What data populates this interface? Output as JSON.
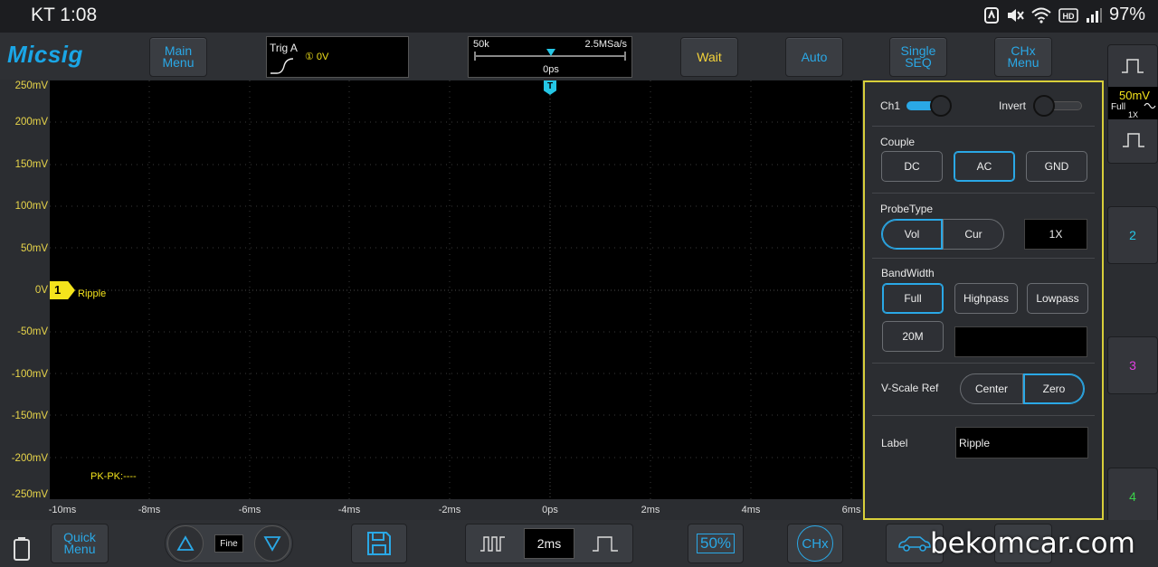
{
  "status_bar": {
    "time_text": "KT 1:08",
    "battery": "97%",
    "icons": [
      "nfc-icon",
      "mute-icon",
      "wifi-icon",
      "hd-icon",
      "signal-icon",
      "battery-icon"
    ]
  },
  "toolbar": {
    "logo": "Micsig",
    "main_menu": [
      "Main",
      "Menu"
    ],
    "trigger": {
      "title": "Trig A",
      "source": "① 0V"
    },
    "timebase": {
      "memory": "50k",
      "sample_rate": "2.5MSa/s",
      "position": "0ps"
    },
    "wait": "Wait",
    "auto": "Auto",
    "single_seq": [
      "Single",
      "SEQ"
    ],
    "chx_menu": [
      "CHx",
      "Menu"
    ]
  },
  "screen": {
    "y_ticks": [
      "250mV",
      "200mV",
      "150mV",
      "100mV",
      "50mV",
      "0V",
      "-50mV",
      "-100mV",
      "-150mV",
      "-200mV",
      "-250mV"
    ],
    "x_ticks": [
      "-10ms",
      "-8ms",
      "-6ms",
      "-4ms",
      "-2ms",
      "0ps",
      "2ms",
      "4ms",
      "6ms"
    ],
    "ch1_marker": "1",
    "ch1_label": "Ripple",
    "trigger_marker": "T",
    "measurement": "PK-PK:----"
  },
  "side_panel": {
    "ch1_label": "Ch1",
    "ch1_on": true,
    "invert_label": "Invert",
    "invert_on": false,
    "couple_label": "Couple",
    "couple_options": [
      "DC",
      "AC",
      "GND"
    ],
    "couple_selected": "AC",
    "probe_label": "ProbeType",
    "probe_options": [
      "Vol",
      "Cur"
    ],
    "probe_selected": "Vol",
    "probe_ratio": "1X",
    "bandwidth_label": "BandWidth",
    "bandwidth_options": [
      "Full",
      "Highpass",
      "Lowpass",
      "20M"
    ],
    "bandwidth_selected": "Full",
    "vscale_label": "V-Scale Ref",
    "vscale_options": [
      "Center",
      "Zero"
    ],
    "vscale_selected": "Zero",
    "label_label": "Label",
    "label_value": "Ripple"
  },
  "channels": {
    "ch1_scale": "50mV",
    "ch1_bw": "Full",
    "ch1_probe": "1X",
    "ch2": "2",
    "ch3": "3",
    "ch4": "4",
    "colors": {
      "ch1": "#f4e41c",
      "ch2": "#25c7e6",
      "ch3": "#e040e0",
      "ch4": "#3ad24a"
    }
  },
  "bottom_bar": {
    "quick_menu": [
      "Quick",
      "Menu"
    ],
    "fine": "Fine",
    "timebase": "2ms",
    "fifty": "50%",
    "chx": "CHx"
  },
  "watermark": "bekomcar.com"
}
